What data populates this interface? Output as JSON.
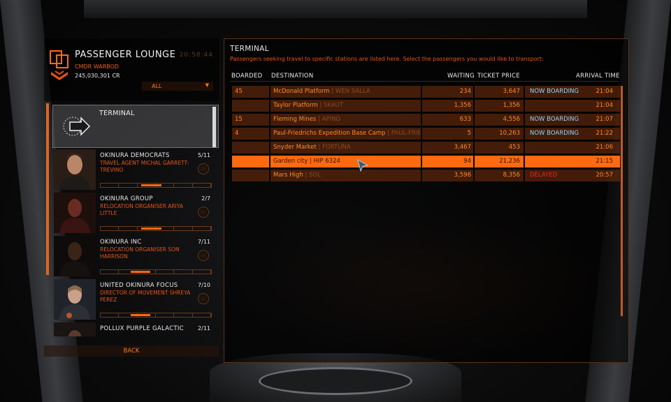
{
  "lounge": {
    "title": "PASSENGER LOUNGE",
    "time": "20:58:44",
    "cmdr": "CMDR WARBOD",
    "credits": "245,030,301 CR",
    "filter": "ALL"
  },
  "sidebar": {
    "terminal_label": "TERMINAL",
    "back_label": "BACK",
    "items": [
      {
        "name": "OKINURA DEMOCRATS",
        "role": "TRAVEL AGENT MICHAL GARRETT-TREVINO",
        "count": "5/11",
        "rep": 0.55
      },
      {
        "name": "OKINURA GROUP",
        "role": "RELOCATION ORGANISER ARIYA LITTLE",
        "count": "2/7",
        "rep": 0.55
      },
      {
        "name": "OKINURA INC",
        "role": "RELOCATION ORGANISER SON HARRISON",
        "count": "7/11",
        "rep": 0.45
      },
      {
        "name": "UNITED OKINURA FOCUS",
        "role": "DIRECTOR OF MOVEMENT SHREYA PEREZ",
        "count": "7/10",
        "rep": 0.45
      },
      {
        "name": "POLLUX PURPLE GALACTIC",
        "role": "",
        "count": "2/11",
        "rep": 0.4
      }
    ]
  },
  "terminal": {
    "title": "TERMINAL",
    "subtitle": "Passengers seeking travel to specific stations are listed here. Select the passengers you would like to transport:",
    "headers": {
      "boarded": "BOARDED",
      "destination": "DESTINATION",
      "waiting": "WAITING",
      "price": "TICKET PRICE",
      "arrival": "ARRIVAL TIME"
    },
    "rows": [
      {
        "boarded": "45",
        "station": "McDonald Platform",
        "system": "| WEN SALLA",
        "waiting": "234",
        "price": "3,647",
        "status": "NOW BOARDING",
        "time": "21:04"
      },
      {
        "boarded": "",
        "station": "Taylor Platform",
        "system": "| SKAUT",
        "waiting": "1,356",
        "price": "1,356",
        "status": "",
        "time": "21:04"
      },
      {
        "boarded": "15",
        "station": "Fleming Mines",
        "system": "| APINO",
        "waiting": "633",
        "price": "4,556",
        "status": "NOW BOARDING",
        "time": "21:07"
      },
      {
        "boarded": "4",
        "station": "Paul-Friedrichs Expedition Base Camp",
        "system": "| PAUL-FRIE...",
        "waiting": "5",
        "price": "10,263",
        "status": "NOW BOARDING",
        "time": "21:22"
      },
      {
        "boarded": "",
        "station": "Snyder Market",
        "system": "| FORTUNA",
        "waiting": "3,467",
        "price": "453",
        "status": "",
        "time": "21:06"
      },
      {
        "boarded": "",
        "station": "Garden city",
        "system": "| HIP 6324",
        "waiting": "94",
        "price": "21,236",
        "status": "",
        "time": "21:15"
      },
      {
        "boarded": "",
        "station": "Mars High",
        "system": "| SOL",
        "waiting": "3,596",
        "price": "8,356",
        "status": "DELAYED",
        "time": "20:57"
      }
    ],
    "selected_index": 5
  },
  "colors": {
    "accent": "#ff6a10",
    "status_boarding": "#8fd4ff",
    "status_delayed": "#e0301a"
  }
}
